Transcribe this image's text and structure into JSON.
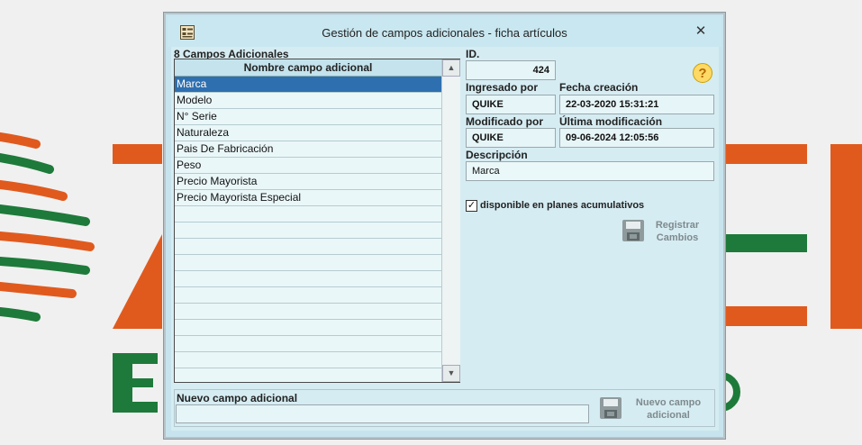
{
  "dialog": {
    "title": "Gestión de campos adicionales - ficha artículos",
    "close_symbol": "✕"
  },
  "list": {
    "count_label": "8 Campos Adicionales",
    "column_header": "Nombre campo adicional",
    "items": [
      "Marca",
      "Modelo",
      "N° Serie",
      "Naturaleza",
      "Pais De Fabricación",
      "Peso",
      "Precio Mayorista",
      "Precio Mayorista Especial"
    ],
    "selected_index": 0,
    "empty_rows": 10
  },
  "details": {
    "id_label": "ID.",
    "id_value": "424",
    "created_by_label": "Ingresado por",
    "created_by_value": "QUIKE",
    "created_date_label": "Fecha creación",
    "created_date_value": "22-03-2020 15:31:21",
    "modified_by_label": "Modificado por",
    "modified_by_value": "QUIKE",
    "modified_date_label": "Última modificación",
    "modified_date_value": "09-06-2024 12:05:56",
    "description_label": "Descripción",
    "description_value": "Marca",
    "cumulative_label": "disponible en planes acumulativos",
    "cumulative_checked": true,
    "save_label_1": "Registrar",
    "save_label_2": "Cambios",
    "help_symbol": "?"
  },
  "new_field": {
    "label": "Nuevo campo adicional",
    "value": "",
    "button_label_1": "Nuevo campo",
    "button_label_2": "adicional"
  },
  "colors": {
    "dialog_bg": "#c7e4ee",
    "selection": "#2e6fb0",
    "brand_orange": "#e05a1e",
    "brand_green": "#1e7a3a"
  }
}
